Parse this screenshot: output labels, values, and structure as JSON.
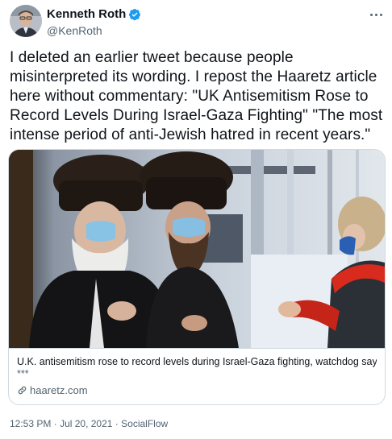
{
  "author": {
    "display_name": "Kenneth Roth",
    "handle": "@KenRoth",
    "verified": true
  },
  "tweet": {
    "text": "I deleted an earlier tweet because people misinterpreted its wording. I repost the Haaretz article here without commentary: \"UK Antisemitism Rose to Record Levels During Israel-Gaza Fighting\" \"The most intense period of anti-Jewish hatred in recent years.\""
  },
  "card": {
    "title": "U.K. antisemitism rose to record levels during Israel-Gaza fighting, watchdog says",
    "description": "***",
    "domain": "haaretz.com"
  },
  "meta": {
    "time": "12:53 PM",
    "separator": "·",
    "date": "Jul 20, 2021",
    "source": "SocialFlow"
  },
  "icons": {
    "verified": "verified-badge-icon",
    "more": "more-options-icon",
    "link": "link-icon"
  },
  "colors": {
    "verified_blue": "#1d9bf0",
    "secondary_text": "#536471",
    "border": "#cfd9de"
  }
}
